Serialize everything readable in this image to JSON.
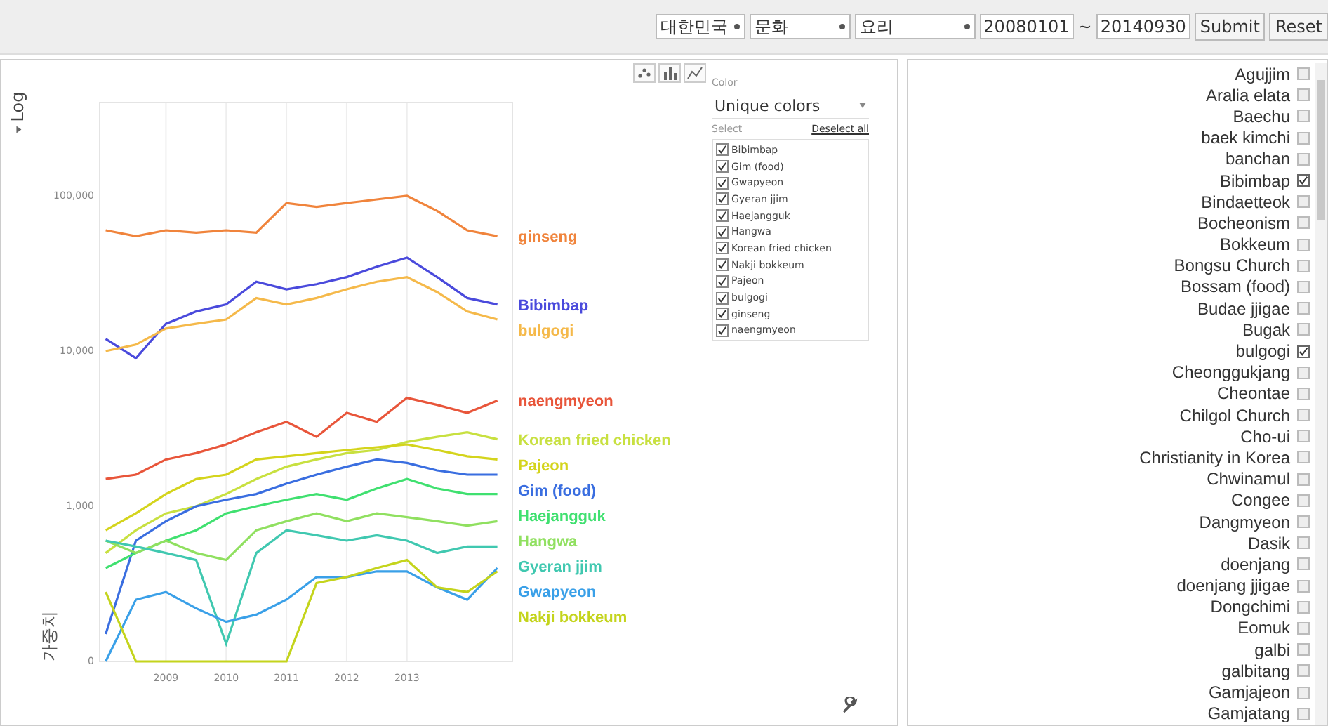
{
  "toolbar": {
    "country": "대한민국",
    "category": "문화",
    "subcategory": "요리",
    "start_date": "20080101",
    "range_separator": "~",
    "end_date": "20140930",
    "buttons": [
      "Submit",
      "Reset"
    ]
  },
  "chart": {
    "scale_button": "Log",
    "axis_title": "가중치",
    "y_ticks": [
      "100,000",
      "10,000",
      "1,000",
      "0"
    ],
    "x_ticks": [
      "2009",
      "2010",
      "2011",
      "2012",
      "2013"
    ],
    "series": [
      {
        "name": "ginseng",
        "color": "#f0843c"
      },
      {
        "name": "Bibimbap",
        "color": "#4a4adc"
      },
      {
        "name": "bulgogi",
        "color": "#f5b94a"
      },
      {
        "name": "naengmyeon",
        "color": "#e8553a"
      },
      {
        "name": "Korean fried chicken",
        "color": "#c8e040"
      },
      {
        "name": "Pajeon",
        "color": "#d4d41c"
      },
      {
        "name": "Gim (food)",
        "color": "#3a6ee0"
      },
      {
        "name": "Haejangguk",
        "color": "#40e070"
      },
      {
        "name": "Hangwa",
        "color": "#90e060"
      },
      {
        "name": "Gyeran jjim",
        "color": "#40c8b0"
      },
      {
        "name": "Gwapyeon",
        "color": "#3aa0e8"
      },
      {
        "name": "Nakji bokkeum",
        "color": "#c4d41c"
      }
    ]
  },
  "legend_panel": {
    "color_label": "Color",
    "color_mode": "Unique colors",
    "select_label": "Select",
    "deselect_link": "Deselect all",
    "items": [
      {
        "label": "Bibimbap",
        "checked": true
      },
      {
        "label": "Gim (food)",
        "checked": true
      },
      {
        "label": "Gwapyeon",
        "checked": true
      },
      {
        "label": "Gyeran jjim",
        "checked": true
      },
      {
        "label": "Haejangguk",
        "checked": true
      },
      {
        "label": "Hangwa",
        "checked": true
      },
      {
        "label": "Korean fried chicken",
        "checked": true
      },
      {
        "label": "Nakji bokkeum",
        "checked": true
      },
      {
        "label": "Pajeon",
        "checked": true
      },
      {
        "label": "bulgogi",
        "checked": true
      },
      {
        "label": "ginseng",
        "checked": true
      },
      {
        "label": "naengmyeon",
        "checked": true
      }
    ]
  },
  "topic_list": [
    {
      "label": "Agujjim",
      "checked": false
    },
    {
      "label": "Aralia elata",
      "checked": false
    },
    {
      "label": "Baechu",
      "checked": false
    },
    {
      "label": "baek kimchi",
      "checked": false
    },
    {
      "label": "banchan",
      "checked": false
    },
    {
      "label": "Bibimbap",
      "checked": true
    },
    {
      "label": "Bindaetteok",
      "checked": false
    },
    {
      "label": "Bocheonism",
      "checked": false
    },
    {
      "label": "Bokkeum",
      "checked": false
    },
    {
      "label": "Bongsu Church",
      "checked": false
    },
    {
      "label": "Bossam (food)",
      "checked": false
    },
    {
      "label": "Budae jjigae",
      "checked": false
    },
    {
      "label": "Bugak",
      "checked": false
    },
    {
      "label": "bulgogi",
      "checked": true
    },
    {
      "label": "Cheonggukjang",
      "checked": false
    },
    {
      "label": "Cheontae",
      "checked": false
    },
    {
      "label": "Chilgol Church",
      "checked": false
    },
    {
      "label": "Cho-ui",
      "checked": false
    },
    {
      "label": "Christianity in Korea",
      "checked": false
    },
    {
      "label": "Chwinamul",
      "checked": false
    },
    {
      "label": "Congee",
      "checked": false
    },
    {
      "label": "Dangmyeon",
      "checked": false
    },
    {
      "label": "Dasik",
      "checked": false
    },
    {
      "label": "doenjang",
      "checked": false
    },
    {
      "label": "doenjang jjigae",
      "checked": false
    },
    {
      "label": "Dongchimi",
      "checked": false
    },
    {
      "label": "Eomuk",
      "checked": false
    },
    {
      "label": "galbi",
      "checked": false
    },
    {
      "label": "galbitang",
      "checked": false
    },
    {
      "label": "Gamjajeon",
      "checked": false
    },
    {
      "label": "Gamjatang",
      "checked": false
    }
  ]
}
